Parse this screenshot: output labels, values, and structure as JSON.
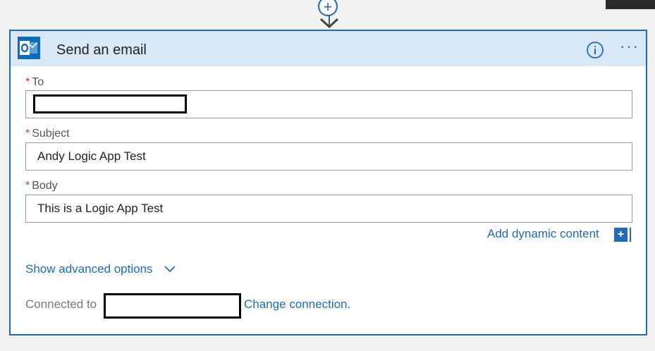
{
  "canvas": {
    "add_step_symbol": "+"
  },
  "card": {
    "title": "Send an email",
    "app_icon": "outlook-icon",
    "accent_color": "#1e6bb8",
    "header_color": "#d8e8f7",
    "more_symbol": "···"
  },
  "fields": {
    "required_marker": "*",
    "to": {
      "label": "To",
      "value": ""
    },
    "subject": {
      "label": "Subject",
      "value": "Andy Logic App Test"
    },
    "body": {
      "label": "Body",
      "value": "This is a Logic App Test"
    }
  },
  "dynamic": {
    "label": "Add dynamic content",
    "button_symbol": "+"
  },
  "advanced": {
    "label": "Show advanced options"
  },
  "connection": {
    "label": "Connected to",
    "change_label": "Change connection."
  }
}
